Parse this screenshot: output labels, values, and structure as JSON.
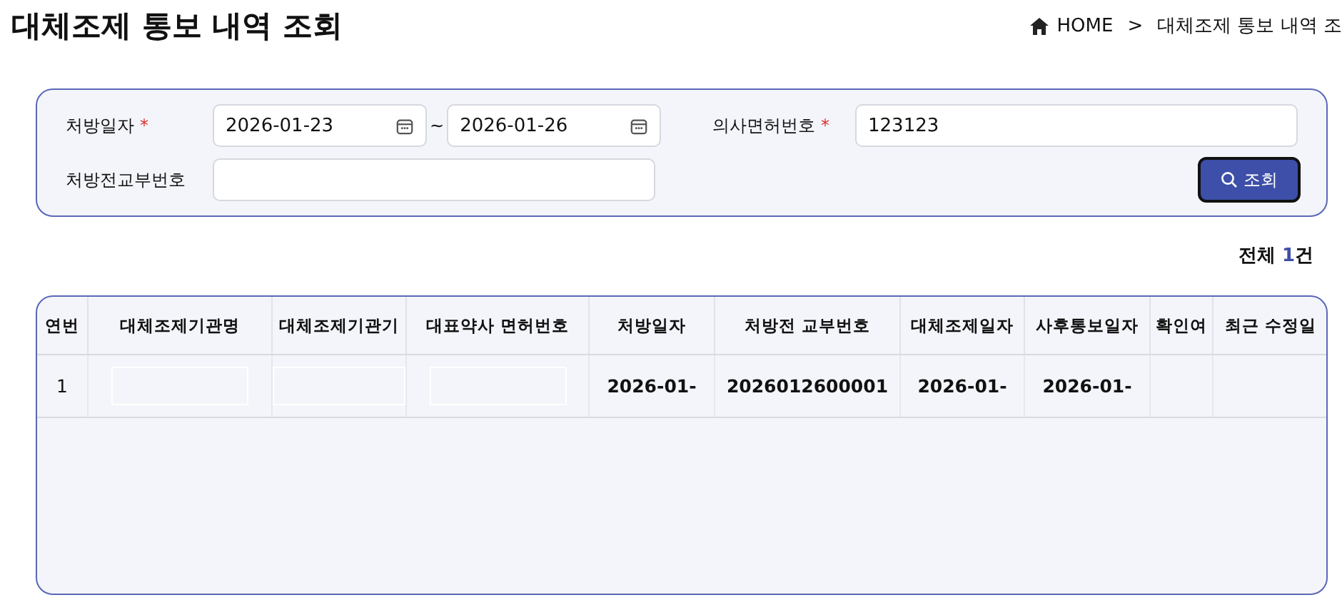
{
  "page_title": "대체조제 통보 내역 조회",
  "breadcrumb": {
    "home": "HOME",
    "separator": ">",
    "current": "대체조제 통보 내역 조"
  },
  "search": {
    "fields": [
      {
        "label": "처방일자",
        "required": true,
        "kind": "daterange",
        "from": "2026-01-23",
        "range_sep": "~",
        "to": "2026-01-26"
      },
      {
        "label": "의사면허번호",
        "required": true,
        "kind": "text",
        "value": "123123"
      },
      {
        "label": "처방전교부번호",
        "required": false,
        "kind": "text"
      }
    ],
    "required_mark": "*",
    "button": "조회"
  },
  "total": {
    "prefix": "전체 ",
    "count": "1",
    "suffix": "건"
  },
  "table": {
    "columns": [
      "연번",
      "대체조제기관명",
      "대체조제기관기",
      "대표약사 면허번호",
      "처방일자",
      "처방전 교부번호",
      "대체조제일자",
      "사후통보일자",
      "확인여",
      "최근 수정일"
    ],
    "rows": [
      {
        "cells": [
          {
            "kind": "text",
            "text": "1"
          },
          {
            "kind": "empty_box"
          },
          {
            "kind": "empty_box"
          },
          {
            "kind": "empty_box"
          },
          {
            "kind": "text",
            "text": "2026-01-"
          },
          {
            "kind": "text",
            "text": "2026012600001"
          },
          {
            "kind": "text",
            "text": "2026-01-"
          },
          {
            "kind": "text",
            "text": "2026-01-"
          },
          {
            "kind": "blank"
          },
          {
            "kind": "blank"
          }
        ]
      }
    ]
  }
}
